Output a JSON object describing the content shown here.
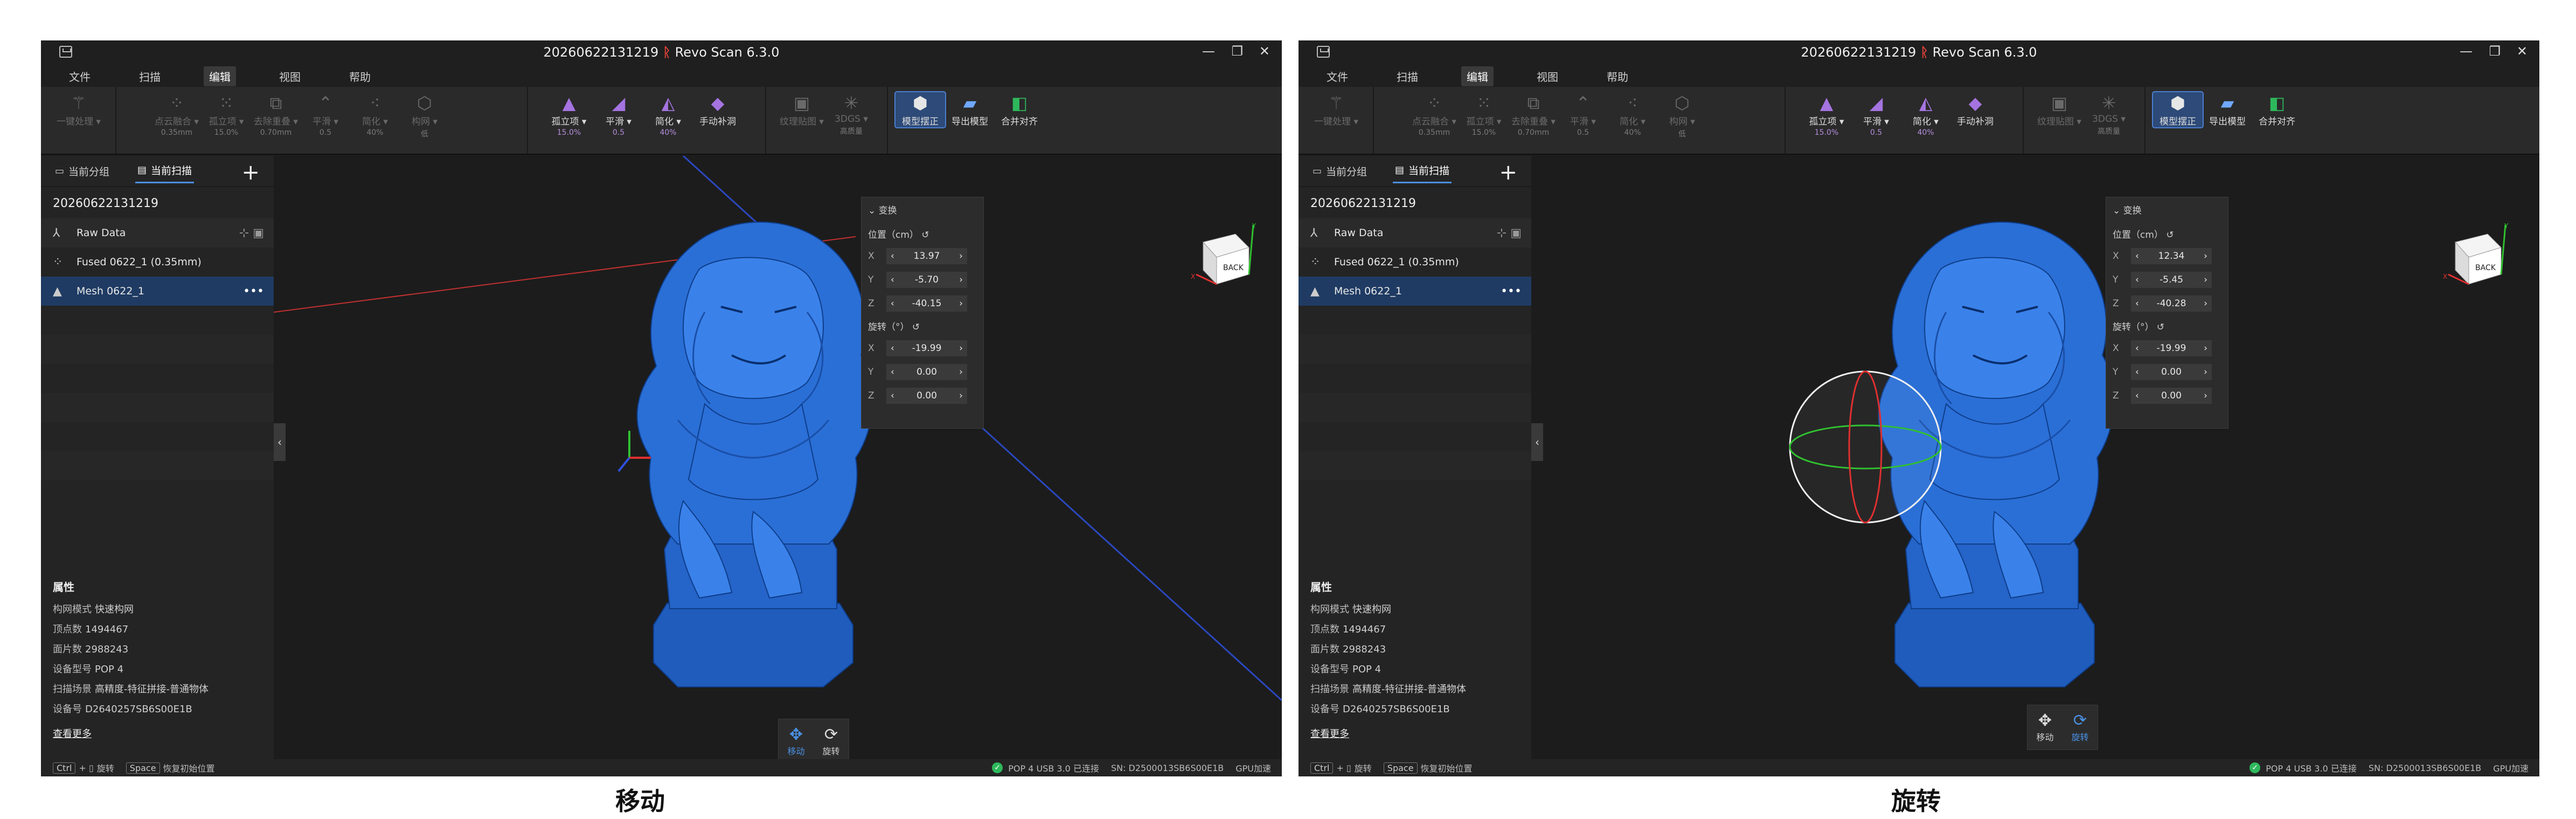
{
  "app": {
    "title": "20260622131219",
    "product": "Revo Scan 6.3.0",
    "brand_color": "#e0423a",
    "accent_color": "#4a90e2"
  },
  "window_controls": [
    "—",
    "❐",
    "✕"
  ],
  "menu": [
    "文件",
    "扫描",
    "编辑",
    "视图",
    "帮助"
  ],
  "ribbon": {
    "g1": [
      {
        "label": "一键处理 ▾",
        "icon": "magic-wand-icon",
        "sub": ""
      }
    ],
    "g2": [
      {
        "label": "点云融合 ▾",
        "sub": "0.35mm"
      },
      {
        "label": "孤立项 ▾",
        "sub": "15.0%"
      },
      {
        "label": "去除重叠 ▾",
        "sub": "0.70mm"
      },
      {
        "label": "平滑 ▾",
        "sub": "0.5"
      },
      {
        "label": "简化 ▾",
        "sub": "40%"
      },
      {
        "label": "构网 ▾",
        "sub": "低"
      }
    ],
    "g3": [
      {
        "label": "孤立项 ▾",
        "sub": "15.0%"
      },
      {
        "label": "平滑 ▾",
        "sub": "0.5"
      },
      {
        "label": "简化 ▾",
        "sub": "40%"
      },
      {
        "label": "手动补洞",
        "sub": ""
      }
    ],
    "g4": [
      {
        "label": "纹理贴图 ▾",
        "sub": ""
      },
      {
        "label": "3DGS ▾",
        "sub": "高质量"
      }
    ],
    "g5": [
      {
        "label": "模型摆正",
        "sub": ""
      },
      {
        "label": "导出模型",
        "sub": ""
      },
      {
        "label": "合并对齐",
        "sub": ""
      }
    ]
  },
  "sidebar": {
    "tabs": [
      "当前分组",
      "当前扫描"
    ],
    "add": "+",
    "project": "20260622131219",
    "items": [
      {
        "label": "Raw Data"
      },
      {
        "label": "Fused 0622_1 (0.35mm)"
      },
      {
        "label": "Mesh 0622_1",
        "menu": "•••"
      }
    ]
  },
  "properties": {
    "heading": "属性",
    "rows": [
      {
        "k": "构网模式",
        "v": "快速构网"
      },
      {
        "k": "顶点数",
        "v": "1494467"
      },
      {
        "k": "面片数",
        "v": "2988243"
      },
      {
        "k": "设备型号",
        "v": "POP 4"
      },
      {
        "k": "扫描场景",
        "v": "高精度-特征拼接-普通物体"
      },
      {
        "k": "设备号",
        "v": "D2640257SB6S00E1B"
      }
    ],
    "more": "查看更多"
  },
  "transform": {
    "heading": "变换",
    "pos_label": "位置（cm）",
    "rot_label": "旋转（°）",
    "axes": [
      "X",
      "Y",
      "Z"
    ]
  },
  "panels": {
    "left": {
      "pos": [
        "13.97",
        "-5.70",
        "-40.15"
      ],
      "rot": [
        "-19.99",
        "0.00",
        "0.00"
      ],
      "caption": "移动",
      "active_tool": "move"
    },
    "right": {
      "pos": [
        "12.34",
        "-5.45",
        "-40.28"
      ],
      "rot": [
        "-19.99",
        "0.00",
        "0.00"
      ],
      "caption": "旋转",
      "active_tool": "rotate"
    }
  },
  "tools": {
    "move": "移动",
    "rotate": "旋转"
  },
  "status": {
    "ctrl": "Ctrl",
    "rotate_hint": "旋转",
    "space": "Space",
    "reset_hint": "恢复初始位置",
    "device": "POP 4 USB 3.0 已连接",
    "sn": "SN: D2500013SB6S00E1B",
    "gpu": "GPU加速"
  },
  "navcube_label": "BACK",
  "model_color": "#2a6fd6"
}
